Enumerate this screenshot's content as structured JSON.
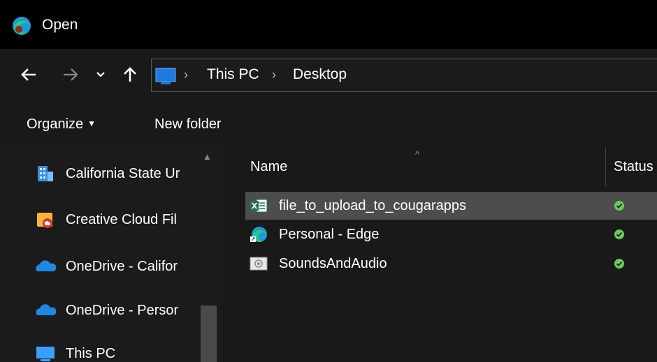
{
  "window": {
    "title": "Open"
  },
  "address": {
    "crumbs": [
      "This PC",
      "Desktop"
    ]
  },
  "toolbar": {
    "organize_label": "Organize",
    "new_folder_label": "New folder"
  },
  "navpane": {
    "items": [
      {
        "label": "California State Ur",
        "icon": "building-icon"
      },
      {
        "label": "Creative Cloud Fil",
        "icon": "creative-cloud-folder-icon"
      },
      {
        "label": "OneDrive - Califor",
        "icon": "onedrive-cloud-icon"
      },
      {
        "label": "OneDrive - Persor",
        "icon": "onedrive-cloud-icon"
      },
      {
        "label": "This PC",
        "icon": "computer-icon"
      }
    ]
  },
  "filelist": {
    "columns": {
      "name": "Name",
      "status": "Status"
    },
    "rows": [
      {
        "name": "file_to_upload_to_cougarapps",
        "icon": "excel-file-icon",
        "status": "synced",
        "selected": true
      },
      {
        "name": "Personal - Edge",
        "icon": "edge-shortcut-icon",
        "status": "synced",
        "selected": false
      },
      {
        "name": "SoundsAndAudio",
        "icon": "sound-shortcut-icon",
        "status": "synced",
        "selected": false
      }
    ]
  },
  "colors": {
    "status_green": "#6ccb5f",
    "selected_row": "#4d4d4d",
    "address_icon": "#1e7ae0"
  }
}
